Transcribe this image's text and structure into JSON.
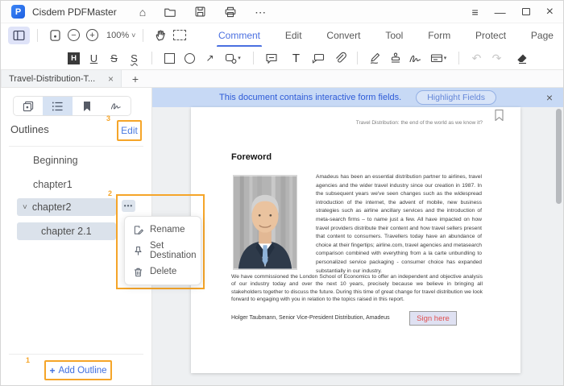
{
  "window": {
    "title": "Cisdem PDFMaster"
  },
  "glyphs": {
    "home": "⌂",
    "more": "⋯",
    "menu": "≡",
    "minimize": "—",
    "close": "×",
    "zoom_out": "−",
    "zoom_in": "+",
    "caret_down": "˅",
    "dd_caret": "▾",
    "highlight": "H",
    "underline": "U",
    "strike": "S",
    "squiggly": "S",
    "arrow": "↗",
    "text": "T",
    "undo": "↶",
    "redo": "↷",
    "tab_close": "×",
    "new_tab": "+",
    "chevron_down": "˅",
    "more_dots": "•••",
    "plus": "+"
  },
  "toolbar": {
    "zoom_value": "100%",
    "tabs": [
      {
        "label": "Comment"
      },
      {
        "label": "Edit"
      },
      {
        "label": "Convert"
      },
      {
        "label": "Tool"
      },
      {
        "label": "Form"
      },
      {
        "label": "Protect"
      },
      {
        "label": "Page"
      }
    ]
  },
  "doctab": {
    "title": "Travel-Distribution-T..."
  },
  "sidebar": {
    "title": "Outlines",
    "edit": "Edit",
    "steps": {
      "add": "1",
      "menu": "2",
      "edit": "3"
    },
    "items": [
      {
        "label": "Beginning"
      },
      {
        "label": "chapter1"
      },
      {
        "label": "chapter2"
      },
      {
        "label": "chapter 2.1"
      }
    ],
    "add_label": "Add Outline"
  },
  "menu": {
    "items": [
      {
        "label": "Rename"
      },
      {
        "label": "Set Destination"
      },
      {
        "label": "Delete"
      }
    ]
  },
  "notification": {
    "message": "This document contains interactive form fields.",
    "action": "Highlight Fields"
  },
  "document": {
    "running_header": "Travel Distribution: the end of the world as we know it?",
    "heading": "Foreword",
    "para1": "Amadeus has been an essential distribution partner to airlines, travel agencies and the wider travel industry since our creation in 1987. In the subsequent years we've seen changes such as the widespread introduction of the internet, the advent of mobile, new business strategies such as airline ancillary services and the introduction of meta-search firms – to name just a few. All have impacted on how travel providers distribute their content and how travel sellers present that content to consumers. Travellers today have an abundance of choice at their fingertips; airline.com, travel agencies and metasearch comparison combined with everything from a la carte unbundling to personalized service packaging - consumer choice has expanded substantially in our industry.",
    "para2": "We have commissioned the London School of Economics to offer an independent and objective analysis of our industry today and over the next 10 years, precisely because we believe in bringing all stakeholders together to discuss the future.  During this time of great change for travel distribution we look forward to engaging with you in relation to the topics raised in this report.",
    "byline": "Holger Taubmann, Senior Vice-President Distribution, Amadeus",
    "sign_field": "Sign here"
  },
  "colors": {
    "accent_orange": "#f5a529",
    "accent_blue": "#4a6fe0",
    "notification_bg": "#c7d9f5",
    "sign_red": "#e04f4f",
    "row_highlight": "#dbe2eb"
  }
}
